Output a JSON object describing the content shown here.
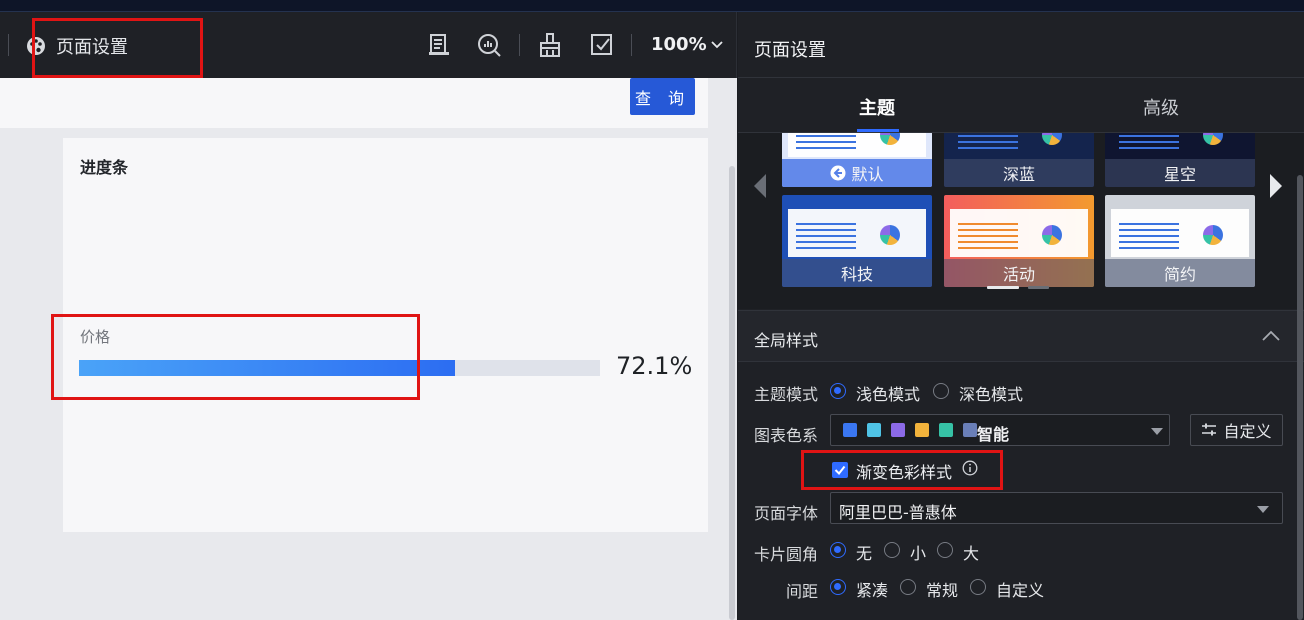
{
  "toolbar": {
    "page_settings_label": "页面设置",
    "zoom": "100%"
  },
  "canvas": {
    "query_button": "查 询",
    "card_title": "进度条",
    "progress": {
      "label": "价格",
      "value_text": "72.1%",
      "value": 0.721
    }
  },
  "panel": {
    "title": "页面设置",
    "tabs": [
      "主题",
      "高级"
    ],
    "active_tab": "主题",
    "themes": [
      {
        "name": "默认",
        "selected": true
      },
      {
        "name": "深蓝",
        "selected": false
      },
      {
        "name": "星空",
        "selected": false
      },
      {
        "name": "科技",
        "selected": false
      },
      {
        "name": "活动",
        "selected": false
      },
      {
        "name": "简约",
        "selected": false
      }
    ],
    "global_style": {
      "section_title": "全局样式",
      "theme_mode_label": "主题模式",
      "theme_mode_options": [
        "浅色模式",
        "深色模式"
      ],
      "theme_mode_selected": "浅色模式",
      "chart_palette_label": "图表色系",
      "chart_palette_value": "智能",
      "chart_palette_colors": [
        "#3a77f2",
        "#4fc3e6",
        "#8c6ae8",
        "#f2b33c",
        "#36c2a6",
        "#6a7fb8"
      ],
      "custom_button": "自定义",
      "gradient_label": "渐变色彩样式",
      "gradient_checked": true,
      "font_label": "页面字体",
      "font_value": "阿里巴巴-普惠体",
      "corner_label": "卡片圆角",
      "corner_options": [
        "无",
        "小",
        "大"
      ],
      "corner_selected": "无",
      "spacing_label": "间距",
      "spacing_options": [
        "紧凑",
        "常规",
        "自定义"
      ],
      "spacing_selected": "紧凑"
    }
  },
  "colors": {
    "accent": "#2f6bff",
    "query_button": "#2659d7",
    "highlight": "#e01414"
  }
}
